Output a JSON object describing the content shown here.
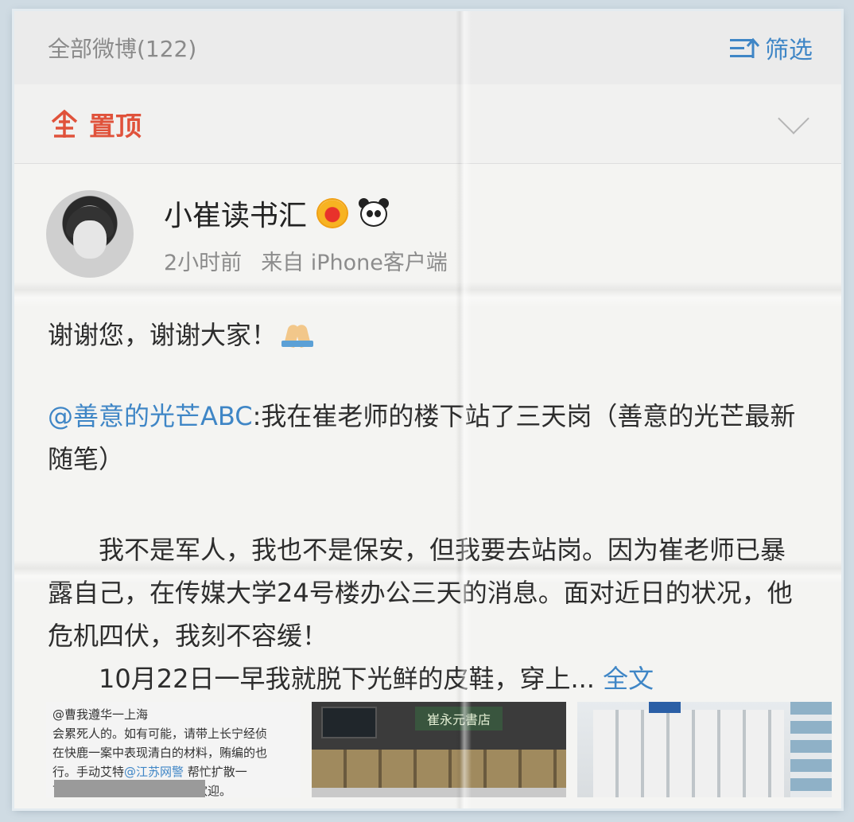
{
  "header": {
    "count_label": "全部微博(122)",
    "filter_label": "筛选"
  },
  "pinned": {
    "label": "置顶"
  },
  "post": {
    "author": "小崔读书汇",
    "time": "2小时前",
    "source": "来自 iPhone客户端",
    "text_main": "谢谢您，谢谢大家！",
    "mention": "@善意的光芒ABC",
    "quote_text": ":我在崔老师的楼下站了三天岗（善意的光芒最新随笔）",
    "para1": "我不是军人，我也不是保安，但我要去站岗。因为崔老师已暴露自己，在传媒大学24号楼办公三天的消息。面对近日的状况，他危机四伏，我刻不容缓！",
    "para2": "10月22日一早我就脱下光鲜的皮鞋，穿上...",
    "full_text_link": "全文"
  },
  "thumbnails": {
    "thumb1_lines": [
      "@曹我遵华一上海",
      "会累死人的。如有可能，请带上长宁经侦",
      "在快鹿一案中表现清白的材料，贿编的也",
      "行。手动艾特",
      "下，你们就别跟着来了，不欢迎。"
    ],
    "thumb1_link": "@江苏网警",
    "thumb1_after_link": " 帮忙扩散一",
    "thumb2_sign": "崔永元書店"
  },
  "colors": {
    "accent_blue": "#3f86c6",
    "pinned_red": "#e0523b"
  },
  "icons": [
    "filter-icon",
    "pin-icon",
    "chevron-down-icon",
    "crown-icon",
    "panda-icon",
    "pray-icon"
  ]
}
